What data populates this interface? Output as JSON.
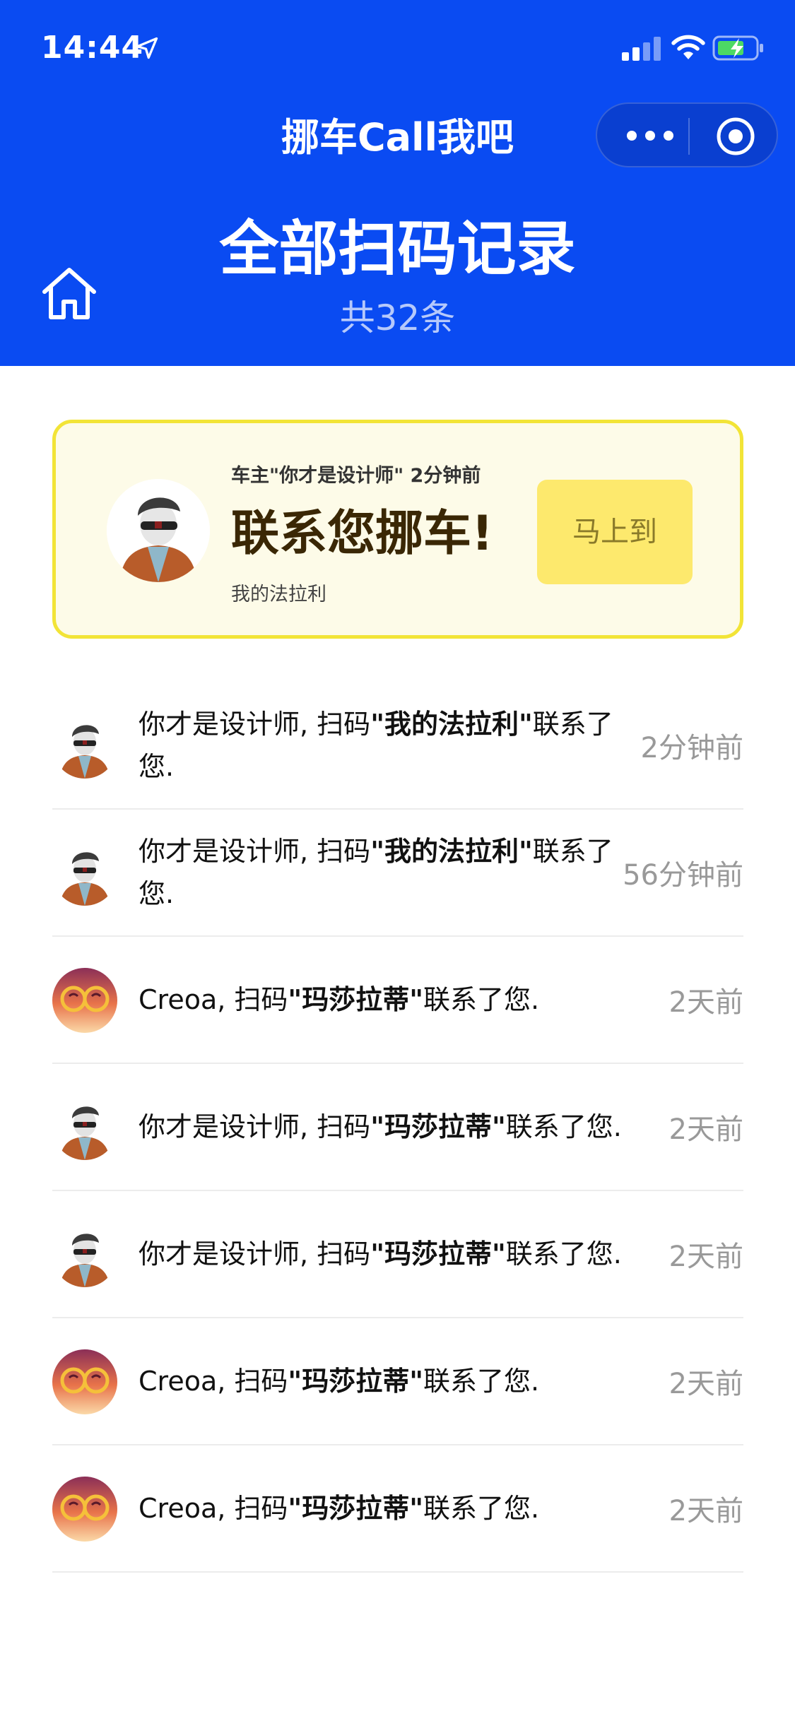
{
  "status": {
    "time": "14:44"
  },
  "app": {
    "title": "挪车Call我吧"
  },
  "header": {
    "title": "全部扫码记录",
    "subtitle": "共32条"
  },
  "notice": {
    "meta": "车主\"你才是设计师\" 2分钟前",
    "headline": "联系您挪车!",
    "plate": "我的法拉利",
    "button": "马上到"
  },
  "records": [
    {
      "avatar": "designer",
      "name": "你才是设计师",
      "mid": ", 扫码",
      "car": "\"我的法拉利\"",
      "tail": "联系了您.",
      "time": "2分钟前"
    },
    {
      "avatar": "designer",
      "name": "你才是设计师",
      "mid": ", 扫码",
      "car": "\"我的法拉利\"",
      "tail": "联系了您.",
      "time": "56分钟前"
    },
    {
      "avatar": "creoa",
      "name": "Creoa",
      "mid": ", 扫码",
      "car": "\"玛莎拉蒂\"",
      "tail": "联系了您.",
      "time": "2天前"
    },
    {
      "avatar": "designer",
      "name": "你才是设计师",
      "mid": ", 扫码",
      "car": "\"玛莎拉蒂\"",
      "tail": "联系了您.",
      "time": "2天前"
    },
    {
      "avatar": "designer",
      "name": "你才是设计师",
      "mid": ", 扫码",
      "car": "\"玛莎拉蒂\"",
      "tail": "联系了您.",
      "time": "2天前"
    },
    {
      "avatar": "creoa",
      "name": "Creoa",
      "mid": ", 扫码",
      "car": "\"玛莎拉蒂\"",
      "tail": "联系了您.",
      "time": "2天前"
    },
    {
      "avatar": "creoa",
      "name": "Creoa",
      "mid": ", 扫码",
      "car": "\"玛莎拉蒂\"",
      "tail": "联系了您.",
      "time": "2天前"
    }
  ],
  "colors": {
    "primary": "#0a4bf2",
    "notice_bg": "#fdfbe8",
    "notice_border": "#f2e437",
    "button": "#fde96d"
  }
}
